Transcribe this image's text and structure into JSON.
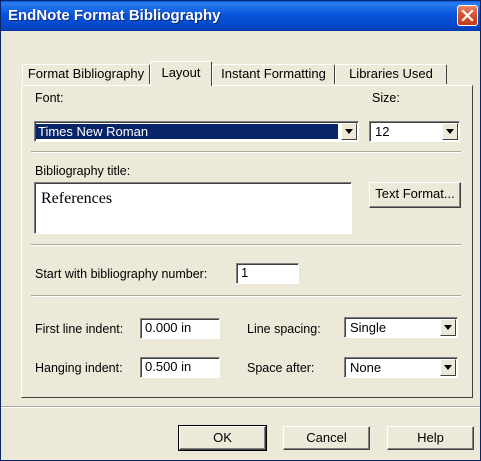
{
  "window": {
    "title": "EndNote Format Bibliography",
    "close_icon": "close-icon",
    "close_color": "#d9532c",
    "titlebar_color": "#0855dd"
  },
  "tabs": [
    {
      "label": "Format Bibliography",
      "active": false
    },
    {
      "label": "Layout",
      "active": true
    },
    {
      "label": "Instant Formatting",
      "active": false
    },
    {
      "label": "Libraries Used",
      "active": false
    }
  ],
  "layout": {
    "font_label": "Font:",
    "font_value": "Times New Roman",
    "size_label": "Size:",
    "size_value": "12",
    "bib_title_label": "Bibliography title:",
    "bib_title_value": "References",
    "text_format_button": "Text Format...",
    "start_number_label": "Start with bibliography number:",
    "start_number_value": "1",
    "first_line_indent_label": "First line indent:",
    "first_line_indent_value": "0.000 in",
    "hanging_indent_label": "Hanging indent:",
    "hanging_indent_value": "0.500 in",
    "line_spacing_label": "Line spacing:",
    "line_spacing_value": "Single",
    "space_after_label": "Space after:",
    "space_after_value": "None"
  },
  "buttons": {
    "ok": "OK",
    "cancel": "Cancel",
    "help": "Help"
  }
}
